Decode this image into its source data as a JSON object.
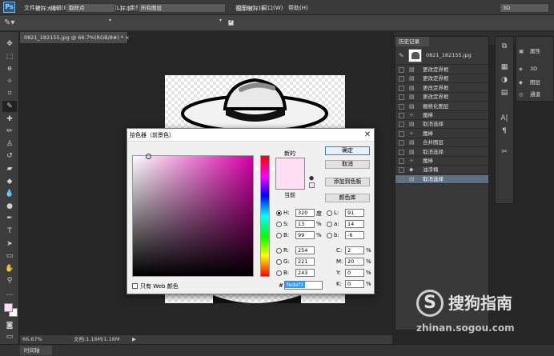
{
  "app": {
    "logo": "Ps"
  },
  "menu": [
    "文件(F)",
    "编辑(E)",
    "图像(I)",
    "图层(L)",
    "类型(Y)",
    "选择(S)",
    "滤镜(T)",
    "3D(D)",
    "视图(V)",
    "窗口(W)",
    "帮助(H)"
  ],
  "options": {
    "sample_size_label": "取样大小:",
    "sample_size_value": "取样点",
    "sample_label": "样本:",
    "sample_value": "所有图层",
    "show_ring_label": "显示取样环",
    "workspace_value": "3D"
  },
  "document": {
    "tab_title": "0821_182155.jpg @ 66.7%(RGB/8#) *",
    "tab_close": "×"
  },
  "status": {
    "zoom": "66.67%",
    "doc_info": "文档:1.16M/1.16M",
    "arrow": "▶"
  },
  "timeline": {
    "label": "时间轴"
  },
  "history": {
    "tab": "历史记录",
    "snapshot": "0821_182155.jpg",
    "items": [
      {
        "label": "更改定界框",
        "icon": "layer-icon"
      },
      {
        "label": "更改定界框",
        "icon": "layer-icon"
      },
      {
        "label": "更改定界框",
        "icon": "layer-icon"
      },
      {
        "label": "更改定界框",
        "icon": "layer-icon"
      },
      {
        "label": "栅格化图层",
        "icon": "layer-icon"
      },
      {
        "label": "魔棒",
        "icon": "magic-wand-icon"
      },
      {
        "label": "取消选择",
        "icon": "layer-icon"
      },
      {
        "label": "魔棒",
        "icon": "magic-wand-icon"
      },
      {
        "label": "合并图层",
        "icon": "layer-icon"
      },
      {
        "label": "取消选择",
        "icon": "layer-icon"
      },
      {
        "label": "魔棒",
        "icon": "magic-wand-icon"
      },
      {
        "label": "油漆桶",
        "icon": "paint-bucket-icon"
      },
      {
        "label": "取消选择",
        "icon": "layer-icon"
      }
    ]
  },
  "right_panels": {
    "properties": "属性",
    "three_d": "3D",
    "layers": "图层",
    "channels": "通道"
  },
  "color_picker": {
    "title": "拾色器（前景色）",
    "new_label": "新的",
    "current_label": "当前",
    "buttons": {
      "ok": "确定",
      "cancel": "取消",
      "add_swatch": "添加到色板",
      "library": "颜色库"
    },
    "hsb": {
      "h_label": "H:",
      "h": "320",
      "h_unit": "度",
      "s_label": "S:",
      "s": "13",
      "s_unit": "%",
      "b_label": "B:",
      "b": "99",
      "b_unit": "%"
    },
    "rgb": {
      "r_label": "R:",
      "r": "254",
      "g_label": "G:",
      "g": "221",
      "b_label": "B:",
      "b": "243"
    },
    "lab": {
      "l_label": "L:",
      "l": "91",
      "a_label": "a:",
      "a": "14",
      "b_label": "b:",
      "b": "-6"
    },
    "cmyk": {
      "c_label": "C:",
      "c": "2",
      "m_label": "M:",
      "m": "20",
      "y_label": "Y:",
      "y": "0",
      "k_label": "K:",
      "k": "0",
      "unit": "%"
    },
    "hex_label": "#",
    "hex": "fedef3",
    "web_only_label": "只有 Web 颜色",
    "swatch_color": "#fedef3",
    "hue_color": "#d600a9"
  },
  "watermark": {
    "brand": "搜狗指南",
    "url": "zhinan.sogou.com"
  }
}
